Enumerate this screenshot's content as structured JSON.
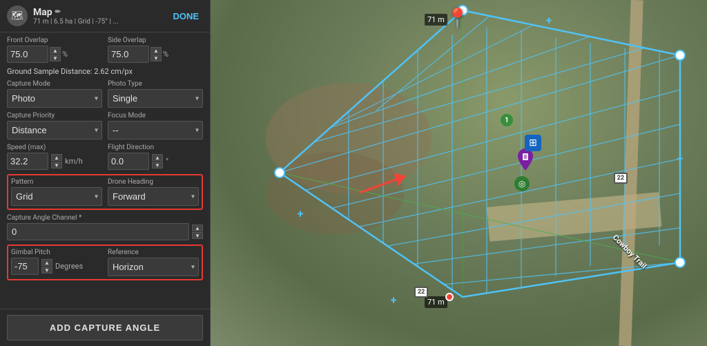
{
  "header": {
    "title": "Map",
    "subtitle": "71 m | 6.5 ha | Grid | -75° | ...",
    "done_label": "DONE",
    "map_icon": "🗺"
  },
  "fields": {
    "front_overlap_label": "Front Overlap",
    "front_overlap_value": "75.0",
    "front_overlap_unit": "%",
    "side_overlap_label": "Side Overlap",
    "side_overlap_value": "75.0",
    "side_overlap_unit": "%",
    "gsd_label": "Ground Sample Distance:",
    "gsd_value": "2.62 cm/px",
    "capture_mode_label": "Capture Mode",
    "capture_mode_value": "Photo",
    "photo_type_label": "Photo Type",
    "photo_type_value": "Single",
    "capture_priority_label": "Capture Priority",
    "capture_priority_value": "Distance",
    "focus_mode_label": "Focus Mode",
    "focus_mode_value": "--",
    "speed_label": "Speed (max)",
    "speed_value": "32.2",
    "speed_unit": "km/h",
    "flight_direction_label": "Flight Direction",
    "flight_direction_value": "0.0",
    "flight_direction_unit": "°",
    "pattern_label": "Pattern",
    "pattern_value": "Grid",
    "drone_heading_label": "Drone Heading",
    "drone_heading_value": "Forward",
    "capture_angle_label": "Capture Angle Channel *",
    "capture_angle_value": "0",
    "gimbal_pitch_label": "Gimbal Pitch",
    "gimbal_pitch_value": "-75",
    "gimbal_pitch_unit": "Degrees",
    "reference_label": "Reference",
    "reference_value": "Horizon",
    "add_capture_label": "ADD CAPTURE ANGLE"
  },
  "map": {
    "distance_top": "71 m",
    "distance_bottom": "71 m",
    "road_label": "Cowboy Trail",
    "highway_number": "22"
  }
}
